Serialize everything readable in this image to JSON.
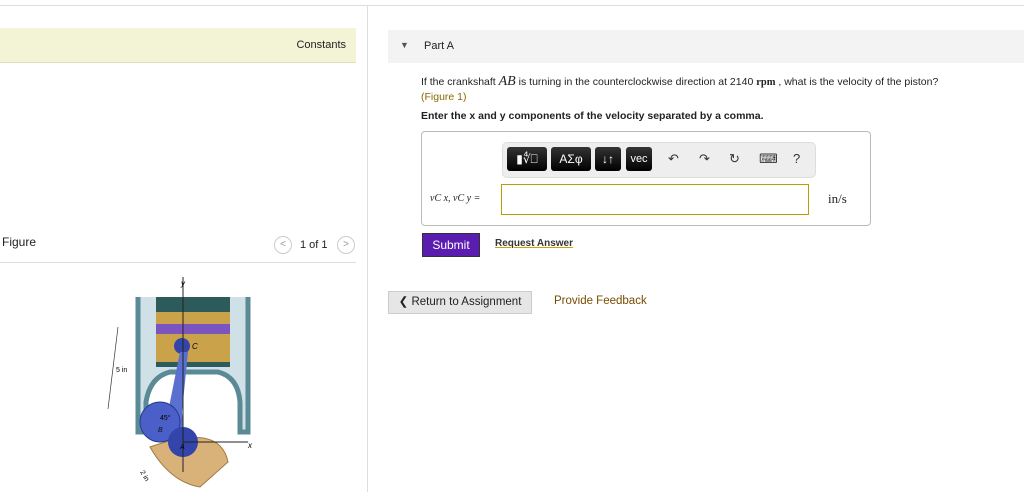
{
  "left": {
    "constants_label": "Constants",
    "figure_label": "Figure",
    "pager": {
      "prev": "<",
      "text": "1 of 1",
      "next": ">"
    },
    "figure_labels": {
      "y": "y",
      "x": "x",
      "c": "C",
      "b": "B",
      "a": "A",
      "angle": "45°",
      "len1": "5 in",
      "len2": "2 in"
    }
  },
  "part": {
    "title": "Part A",
    "question_pre": "If the crankshaft ",
    "var": "AB",
    "question_mid": " is turning in the counterclockwise direction at 2140 ",
    "unit_rpm": "rpm",
    "question_post": " , what is the velocity of the piston?",
    "figure_link": "(Figure 1)",
    "instruction": "Enter the x and y components of the velocity separated by a comma.",
    "toolbar": {
      "templates": "▮∜⎕",
      "greek": "ΑΣφ",
      "arrows": "↓↑",
      "vec": "vec",
      "undo": "↶",
      "redo": "↷",
      "reset": "↻",
      "keyboard": "⌨",
      "help": "?"
    },
    "answer_label": "vC x, vC y =",
    "answer_value": "",
    "unit": "in/s",
    "submit": "Submit",
    "request_answer": "Request Answer"
  },
  "footer": {
    "return": "❮ Return to Assignment",
    "feedback": "Provide Feedback"
  },
  "colors": {
    "submit": "#5a1db0",
    "constants_bg": "#f3f3d6"
  }
}
